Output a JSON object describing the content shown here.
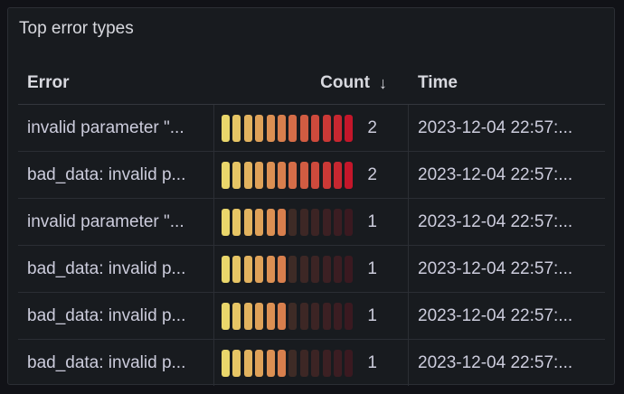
{
  "panel": {
    "title": "Top error types"
  },
  "table": {
    "columns": {
      "error": "Error",
      "count": "Count",
      "time": "Time"
    },
    "sort_icon": "arrow-down-icon",
    "max_count": 2,
    "rows": [
      {
        "error": "invalid parameter \"...",
        "count": 2,
        "count_text": "2",
        "time": "2023-12-04 22:57:..."
      },
      {
        "error": "bad_data: invalid p...",
        "count": 2,
        "count_text": "2",
        "time": "2023-12-04 22:57:..."
      },
      {
        "error": "invalid parameter \"...",
        "count": 1,
        "count_text": "1",
        "time": "2023-12-04 22:57:..."
      },
      {
        "error": "bad_data: invalid p...",
        "count": 1,
        "count_text": "1",
        "time": "2023-12-04 22:57:..."
      },
      {
        "error": "bad_data: invalid p...",
        "count": 1,
        "count_text": "1",
        "time": "2023-12-04 22:57:..."
      },
      {
        "error": "bad_data: invalid p...",
        "count": 1,
        "count_text": "1",
        "time": "2023-12-04 22:57:..."
      }
    ]
  },
  "gauge_colors": {
    "start": "#e9d66b",
    "end": "#c4162a",
    "dim_opacity": 0.2
  }
}
